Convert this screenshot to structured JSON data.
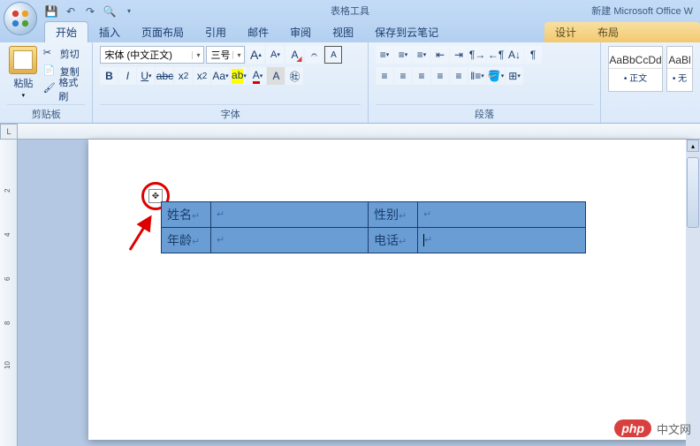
{
  "title": {
    "context_tools": "表格工具",
    "doc_name": "新建 Microsoft Office W"
  },
  "qat": {
    "save": "保存",
    "undo": "撤销",
    "redo": "重做",
    "print": "打印预览"
  },
  "tabs": {
    "home": "开始",
    "insert": "插入",
    "layout": "页面布局",
    "ref": "引用",
    "mail": "邮件",
    "review": "审阅",
    "view": "视图",
    "cloud": "保存到云笔记",
    "design": "设计",
    "tbl_layout": "布局"
  },
  "clipboard": {
    "paste": "粘贴",
    "cut": "剪切",
    "copy": "复制",
    "painter": "格式刷",
    "group": "剪贴板"
  },
  "font": {
    "name": "宋体 (中文正文)",
    "size": "三号",
    "grow": "A",
    "shrink": "A",
    "clear": "Aa",
    "group": "字体"
  },
  "paragraph": {
    "group": "段落"
  },
  "styles": {
    "normal_preview": "AaBbCcDd",
    "normal_name": "• 正文",
    "nospace_preview": "AaBl",
    "nospace_name": "• 无"
  },
  "table": {
    "r1c1": "姓名",
    "r1c3": "性别",
    "r2c1": "年龄",
    "r2c3": "电话"
  },
  "ruler": {
    "corner": "L"
  },
  "watermark": {
    "brand": "php",
    "text": "中文网"
  }
}
